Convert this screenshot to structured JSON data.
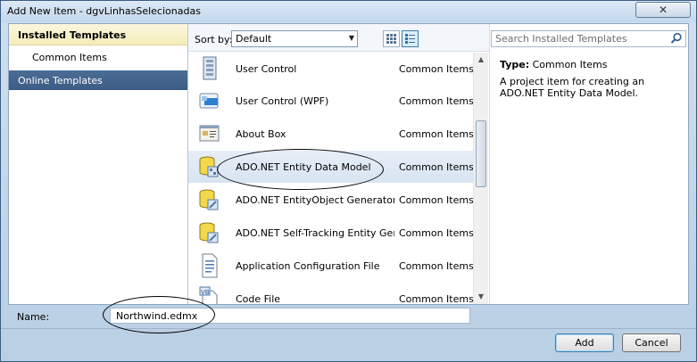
{
  "window": {
    "title": "Add New Item - dgvLinhasSelecionadas",
    "close_glyph": "✕"
  },
  "nav": {
    "installed_templates": "Installed Templates",
    "common_items": "Common Items",
    "online_templates": "Online Templates"
  },
  "toolbar": {
    "sort_by_label": "Sort by:",
    "sort_value": "Default"
  },
  "search": {
    "placeholder": "Search Installed Templates"
  },
  "templates": [
    {
      "name": "User Control",
      "category": "Common Items",
      "icon": "user-control-icon"
    },
    {
      "name": "User Control (WPF)",
      "category": "Common Items",
      "icon": "wpf-user-control-icon"
    },
    {
      "name": "About Box",
      "category": "Common Items",
      "icon": "about-box-icon"
    },
    {
      "name": "ADO.NET Entity Data Model",
      "category": "Common Items",
      "icon": "entity-model-icon",
      "selected": true
    },
    {
      "name": "ADO.NET EntityObject Generator",
      "category": "Common Items",
      "icon": "entity-generator-icon"
    },
    {
      "name": "ADO.NET Self-Tracking Entity Gener...",
      "category": "Common Items",
      "icon": "entity-generator-icon"
    },
    {
      "name": "Application Configuration File",
      "category": "Common Items",
      "icon": "config-file-icon"
    },
    {
      "name": "Code File",
      "category": "Common Items",
      "icon": "code-file-icon"
    }
  ],
  "details": {
    "type_label": "Type:",
    "type_value": "Common Items",
    "description": "A project item for creating an ADO.NET Entity Data Model."
  },
  "name_field": {
    "label": "Name:",
    "value": "Northwind.edmx"
  },
  "buttons": {
    "add": "Add",
    "cancel": "Cancel"
  }
}
